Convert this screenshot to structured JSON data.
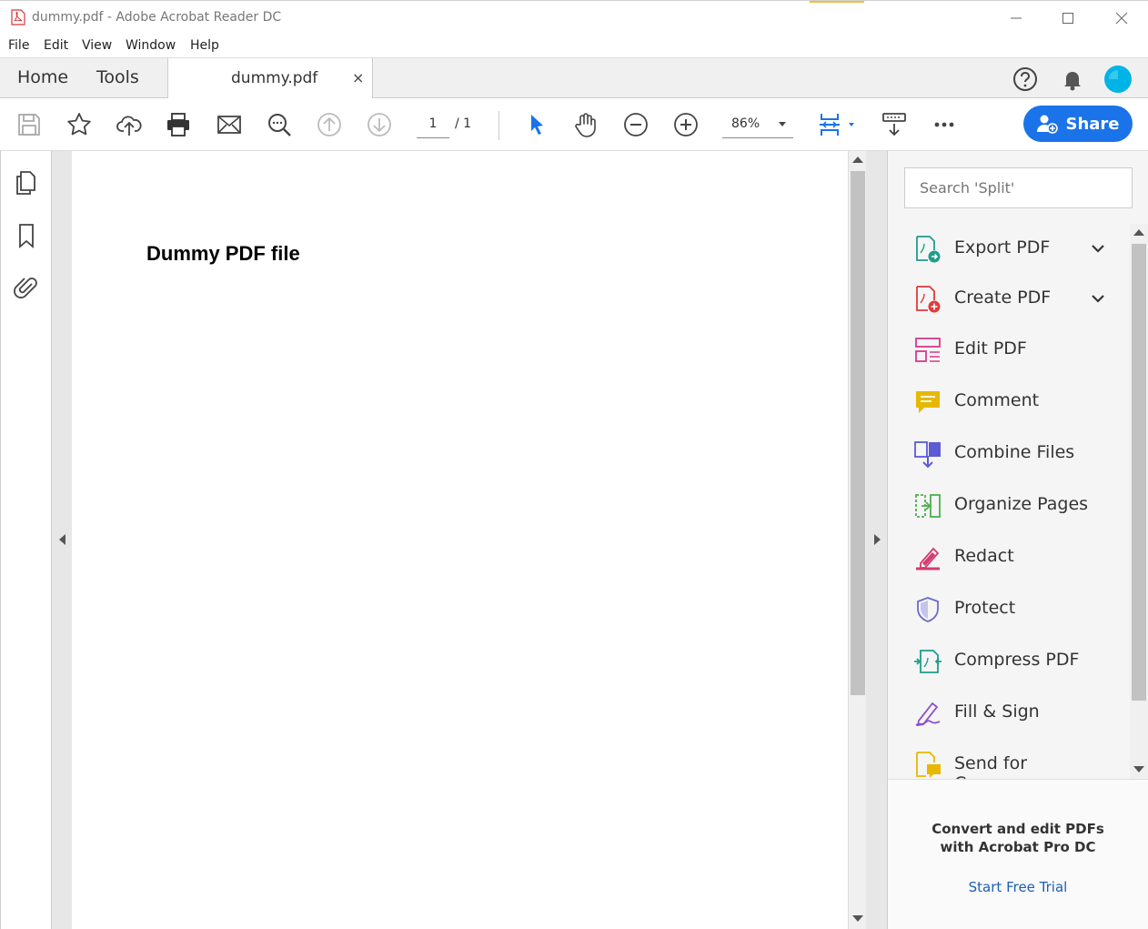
{
  "window": {
    "title": "dummy.pdf - Adobe Acrobat Reader DC"
  },
  "menu": [
    "File",
    "Edit",
    "View",
    "Window",
    "Help"
  ],
  "tabs": {
    "home": "Home",
    "tools": "Tools",
    "document": "dummy.pdf",
    "close": "×"
  },
  "toolbar": {
    "page_current": "1",
    "page_total": "/  1",
    "zoom": "86%",
    "share_label": "Share"
  },
  "document": {
    "heading": "Dummy PDF file"
  },
  "right_pane": {
    "search_placeholder": "Search 'Split'",
    "tools": [
      {
        "label": "Export PDF",
        "color": "#1e9e8a",
        "icon": "export-pdf-icon"
      },
      {
        "label": "Create PDF",
        "color": "#e03a3e",
        "icon": "create-pdf-icon"
      },
      {
        "label": "Edit PDF",
        "color": "#d63a8c",
        "icon": "edit-pdf-icon"
      },
      {
        "label": "Comment",
        "color": "#e6b800",
        "icon": "comment-icon"
      },
      {
        "label": "Combine Files",
        "color": "#5b5bd6",
        "icon": "combine-files-icon"
      },
      {
        "label": "Organize Pages",
        "color": "#4caf50",
        "icon": "organize-pages-icon"
      },
      {
        "label": "Redact",
        "color": "#d63a6e",
        "icon": "redact-icon"
      },
      {
        "label": "Protect",
        "color": "#6a6ad0",
        "icon": "protect-icon"
      },
      {
        "label": "Compress PDF",
        "color": "#1e9e8a",
        "icon": "compress-pdf-icon"
      },
      {
        "label": "Fill & Sign",
        "color": "#8a4fd0",
        "icon": "fill-sign-icon"
      },
      {
        "label": "Send for Comme...",
        "color": "#e6b800",
        "icon": "send-for-comment-icon"
      }
    ],
    "promo_line1": "Convert and edit PDFs",
    "promo_line2": "with Acrobat Pro DC",
    "promo_link": "Start Free Trial"
  },
  "colors": {
    "accent_blue": "#1a73e8",
    "link_blue": "#1a5fb4"
  }
}
